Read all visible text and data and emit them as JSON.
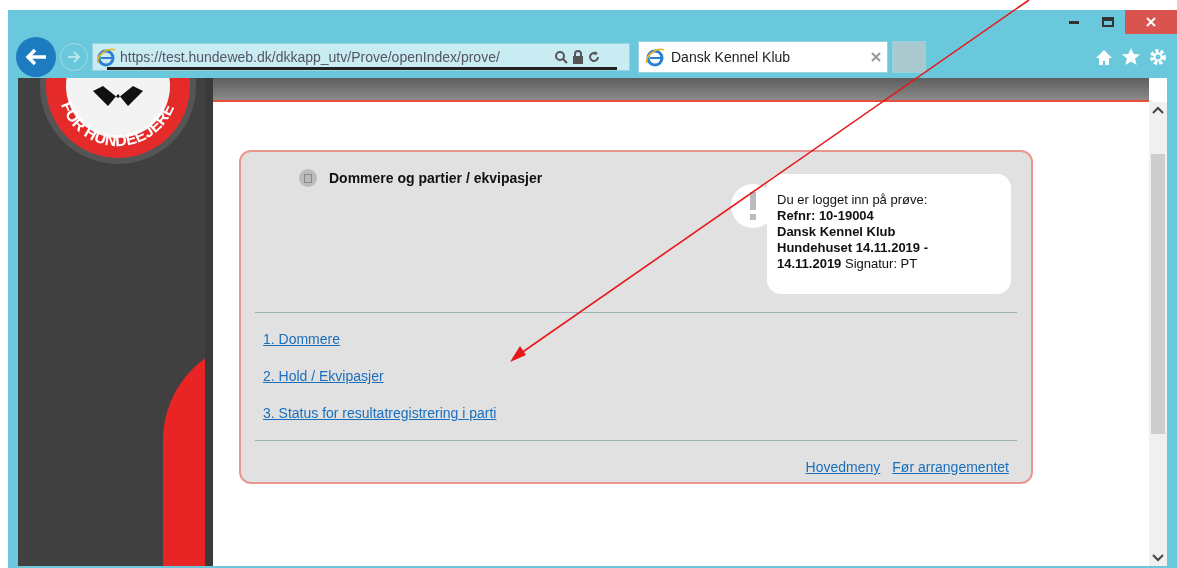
{
  "browser": {
    "address": "https://test.hundeweb.dk/dkkapp_utv/Prove/openIndex/prove/",
    "tabs": [
      {
        "title": "Dansk Kennel Klub",
        "selected": true
      }
    ]
  },
  "logo": {
    "text": "FOR HUNDEEJERE"
  },
  "panel": {
    "title": "Dommere og partier / ekvipasjer",
    "notice": [
      "Du er logget inn på prøve:",
      "**Refnr: 10-19004**",
      "**Dansk Kennel Klub**",
      "**Hundehuset 14.11.2019 -**",
      "**14.11.2019** Signatur: PT"
    ],
    "links": [
      "1. Dommere",
      "2. Hold / Ekvipasjer",
      "3. Status for resultatregistrering i parti"
    ],
    "footer_links": [
      "Hovedmeny",
      "Før arrangementet"
    ]
  }
}
